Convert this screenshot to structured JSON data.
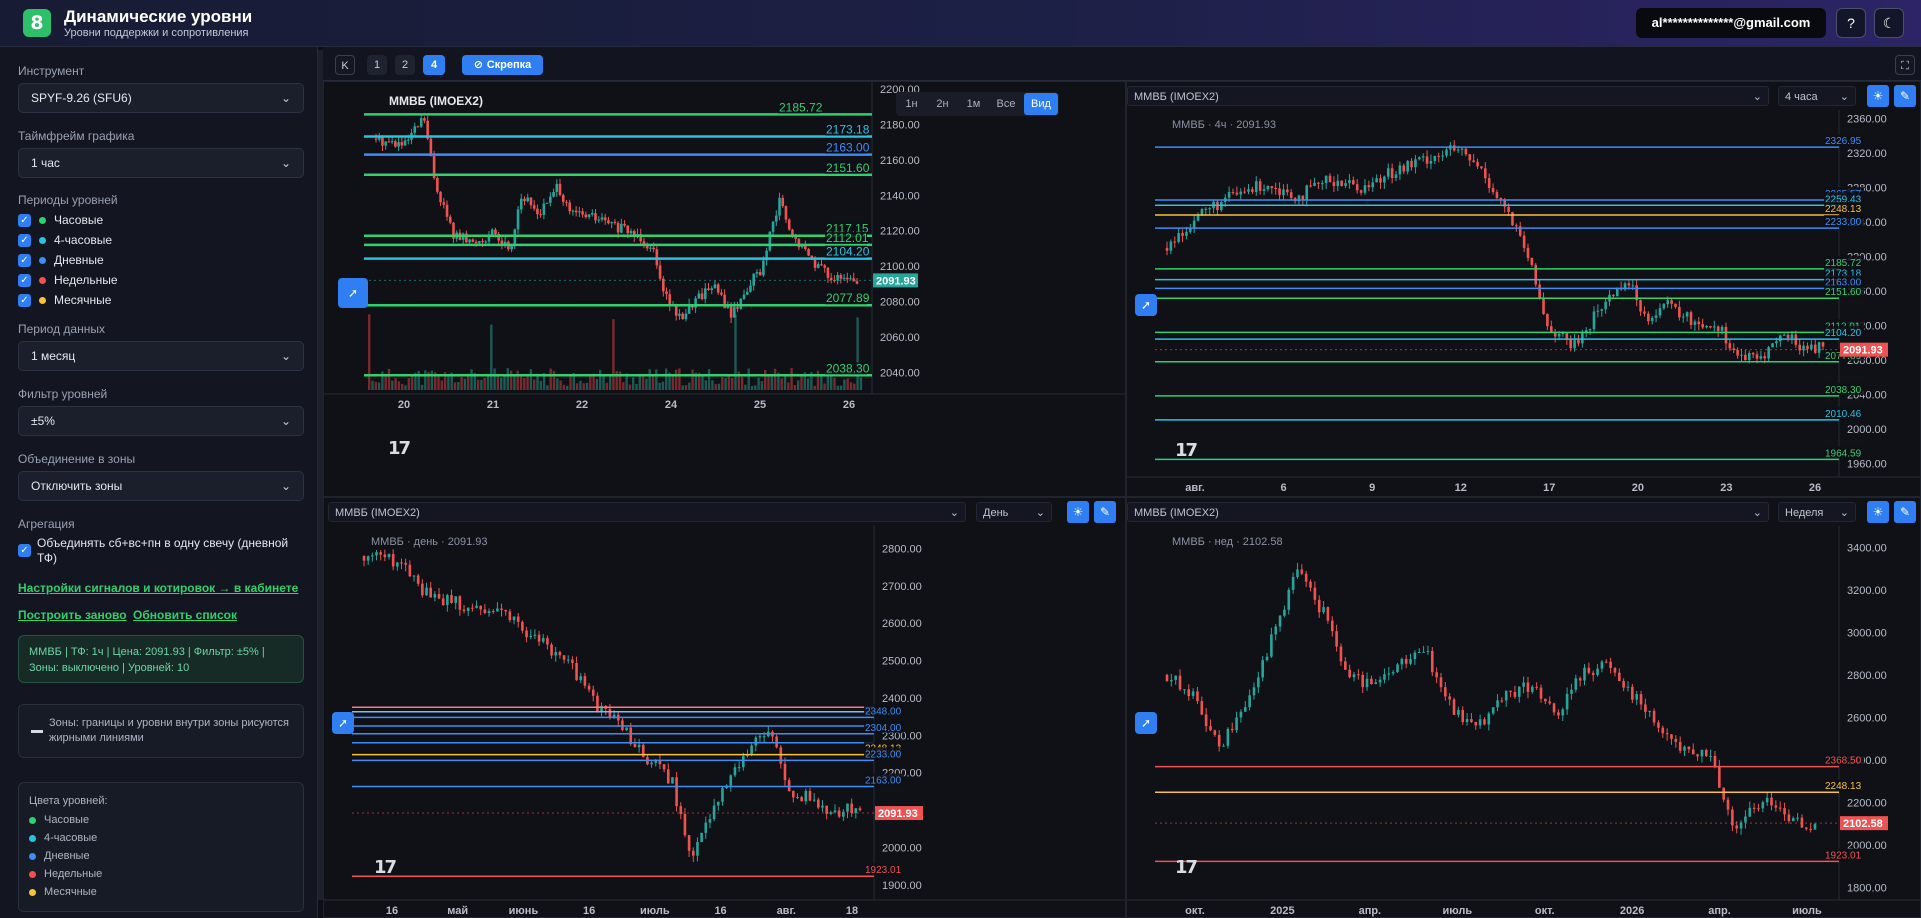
{
  "header": {
    "logo": "8",
    "title": "Динамические уровни",
    "subtitle": "Уровни поддержки и сопротивления",
    "user_email": "al**************@gmail.com",
    "help_icon": "?",
    "theme_icon": "☾"
  },
  "sidebar": {
    "instrument_label": "Инструмент",
    "instrument_value": "SPYF-9.26 (SFU6)",
    "timeframe_label": "Таймфрейм графика",
    "timeframe_value": "1 час",
    "periods_label": "Периоды уровней",
    "periods": [
      {
        "label": "Часовые",
        "color": "#2fd06e"
      },
      {
        "label": "4-часовые",
        "color": "#27c3e0"
      },
      {
        "label": "Дневные",
        "color": "#3d8df5"
      },
      {
        "label": "Недельные",
        "color": "#f05252"
      },
      {
        "label": "Месячные",
        "color": "#f7c23c"
      }
    ],
    "data_period_label": "Период данных",
    "data_period_value": "1 месяц",
    "filter_label": "Фильтр уровней",
    "filter_value": "±5%",
    "zones_label": "Объединение в зоны",
    "zones_value": "Отключить зоны",
    "aggregation_label": "Агрегация",
    "aggregation_checkbox": "Объединять сб+вс+пн в одну свечу (дневной ТФ)",
    "signals_link": "Настройки сигналов и котировок → в кабинете",
    "rebuild_link": "Построить заново",
    "refresh_link": "Обновить список",
    "info_text": "ММВБ | ТФ: 1ч | Цена: 2091.93 | Фильтр: ±5% | Зоны: выключено | Уровней: 10",
    "zones_note": "Зоны: границы и уровни внутри зоны рисуются жирными линиями",
    "legend_title": "Цвета уровней:",
    "legend": [
      {
        "label": "Часовые",
        "color": "#2fd06e"
      },
      {
        "label": "4-часовые",
        "color": "#27c3e0"
      },
      {
        "label": "Дневные",
        "color": "#3d8df5"
      },
      {
        "label": "Недельные",
        "color": "#f05252"
      },
      {
        "label": "Месячные",
        "color": "#f7c23c"
      }
    ]
  },
  "topbar": {
    "collapse": "K",
    "layouts": [
      "1",
      "2",
      "4"
    ],
    "clip_label": "Скрепка",
    "fullscreen_icon": "⛶"
  },
  "charts": [
    {
      "id": "p1",
      "header": null,
      "title": "ММВБ (IMOEX2)",
      "legend_text": "",
      "tf_buttons": [
        "1н",
        "2н",
        "1м",
        "Все",
        "Вид"
      ],
      "ymin": 2030,
      "ymax": 2204,
      "yticks": [
        2200,
        2180,
        2160,
        2140,
        2120,
        2100,
        2080,
        2060,
        2040
      ],
      "xticks": [
        "20",
        "21",
        "22",
        "24",
        "25",
        "26"
      ],
      "price": "2091.93",
      "price_color": "#26a69a",
      "levels": [
        {
          "v": 2185.72,
          "c": "#2fd06e"
        },
        {
          "v": 2173.18,
          "c": "#27c3e0"
        },
        {
          "v": 2163.0,
          "c": "#3d8df5"
        },
        {
          "v": 2151.6,
          "c": "#2fd06e"
        },
        {
          "v": 2117.15,
          "c": "#2fd06e"
        },
        {
          "v": 2112.01,
          "c": "#2fd06e"
        },
        {
          "v": 2104.2,
          "c": "#27c3e0"
        },
        {
          "v": 2077.89,
          "c": "#2fd06e"
        },
        {
          "v": 2038.3,
          "c": "#2fd06e"
        }
      ],
      "path": [
        [
          0,
          2172
        ],
        [
          0.06,
          2168
        ],
        [
          0.1,
          2184
        ],
        [
          0.12,
          2150
        ],
        [
          0.16,
          2118
        ],
        [
          0.2,
          2113
        ],
        [
          0.24,
          2118
        ],
        [
          0.28,
          2110
        ],
        [
          0.3,
          2140
        ],
        [
          0.34,
          2130
        ],
        [
          0.38,
          2145
        ],
        [
          0.4,
          2130
        ],
        [
          0.45,
          2128
        ],
        [
          0.5,
          2122
        ],
        [
          0.55,
          2117
        ],
        [
          0.58,
          2108
        ],
        [
          0.6,
          2085
        ],
        [
          0.63,
          2070
        ],
        [
          0.66,
          2080
        ],
        [
          0.7,
          2090
        ],
        [
          0.74,
          2072
        ],
        [
          0.78,
          2092
        ],
        [
          0.8,
          2097
        ],
        [
          0.84,
          2138
        ],
        [
          0.86,
          2118
        ],
        [
          0.88,
          2112
        ],
        [
          0.92,
          2100
        ],
        [
          0.96,
          2092
        ]
      ],
      "volumes": true
    },
    {
      "id": "p2",
      "header": {
        "symbol": "ММВБ (IMOEX2)",
        "tf": "4 часа"
      },
      "legend_text": "ММВБ · 4ч · 2091.93",
      "ymin": 1950,
      "ymax": 2370,
      "yticks": [
        2360,
        2320,
        2280,
        2240,
        2200,
        2160,
        2120,
        2080,
        2040,
        2000,
        1960
      ],
      "xticks": [
        "авг.",
        "6",
        "9",
        "12",
        "17",
        "20",
        "23",
        "26"
      ],
      "price": "2091.93",
      "price_color": "#f05252",
      "levels": [
        {
          "v": 2326.95,
          "c": "#3d8df5",
          "t": "2326.95"
        },
        {
          "v": 2265.57,
          "c": "#3d8df5",
          "t": "2265.57"
        },
        {
          "v": 2259.43,
          "c": "#27c3e0",
          "t": "2259.43"
        },
        {
          "v": 2248.13,
          "c": "#f7c23c",
          "t": "2248.13"
        },
        {
          "v": 2233.0,
          "c": "#3d8df5",
          "t": "2233.00"
        },
        {
          "v": 2185.72,
          "c": "#2fd06e",
          "t": "2185.72"
        },
        {
          "v": 2173.18,
          "c": "#27c3e0",
          "t": "2173.18"
        },
        {
          "v": 2163.0,
          "c": "#3d8df5",
          "t": "2163.00"
        },
        {
          "v": 2151.6,
          "c": "#2fd06e",
          "t": "2151.60"
        },
        {
          "v": 2112.01,
          "c": "#2fd06e",
          "t": "2112.01"
        },
        {
          "v": 2104.2,
          "c": "#27c3e0",
          "t": "2104.20"
        },
        {
          "v": 2077.89,
          "c": "#2fd06e",
          "t": "2077.89"
        },
        {
          "v": 2038.3,
          "c": "#2fd06e",
          "t": "2038.30"
        },
        {
          "v": 2010.46,
          "c": "#27c3e0",
          "t": "2010.46"
        },
        {
          "v": 1964.59,
          "c": "#2fd06e",
          "t": "1964.59"
        }
      ],
      "path": [
        [
          0,
          2210
        ],
        [
          0.05,
          2250
        ],
        [
          0.1,
          2270
        ],
        [
          0.15,
          2285
        ],
        [
          0.2,
          2270
        ],
        [
          0.25,
          2290
        ],
        [
          0.3,
          2280
        ],
        [
          0.35,
          2300
        ],
        [
          0.4,
          2315
        ],
        [
          0.44,
          2325
        ],
        [
          0.48,
          2300
        ],
        [
          0.52,
          2250
        ],
        [
          0.55,
          2200
        ],
        [
          0.58,
          2120
        ],
        [
          0.62,
          2095
        ],
        [
          0.66,
          2140
        ],
        [
          0.7,
          2175
        ],
        [
          0.73,
          2130
        ],
        [
          0.76,
          2145
        ],
        [
          0.8,
          2125
        ],
        [
          0.84,
          2120
        ],
        [
          0.87,
          2085
        ],
        [
          0.9,
          2080
        ],
        [
          0.94,
          2110
        ],
        [
          0.97,
          2095
        ]
      ],
      "volumes": false
    },
    {
      "id": "p3",
      "header": {
        "symbol": "ММВБ (IMOEX2)",
        "tf": "День"
      },
      "legend_text": "ММВБ · день · 2091.93",
      "ymin": 1870,
      "ymax": 2860,
      "yticks": [
        2800,
        2700,
        2600,
        2500,
        2400,
        2300,
        2200,
        2100,
        2000,
        1900
      ],
      "xticks": [
        "16",
        "май",
        "июнь",
        "16",
        "июль",
        "16",
        "авг.",
        "18"
      ],
      "price": "2091.93",
      "price_color": "#f05252",
      "levels": [
        {
          "v": 2375,
          "c": "#f08080",
          "t": ""
        },
        {
          "v": 2363,
          "c": "#7fb8ff",
          "t": ""
        },
        {
          "v": 2348.0,
          "c": "#3d8df5",
          "t": "2348.00"
        },
        {
          "v": 2325,
          "c": "#3d8df5",
          "t": ""
        },
        {
          "v": 2304.0,
          "c": "#3d8df5",
          "t": "2304.00"
        },
        {
          "v": 2280,
          "c": "#3d8df5",
          "t": ""
        },
        {
          "v": 2248.13,
          "c": "#f7c23c",
          "t": "2248.13"
        },
        {
          "v": 2233.0,
          "c": "#3d8df5",
          "t": "2233.00"
        },
        {
          "v": 2163.0,
          "c": "#3d8df5",
          "t": "2163.00"
        },
        {
          "v": 1923.01,
          "c": "#f05252",
          "t": "1923.01"
        }
      ],
      "path": [
        [
          0,
          2780
        ],
        [
          0.08,
          2760
        ],
        [
          0.12,
          2680
        ],
        [
          0.2,
          2650
        ],
        [
          0.28,
          2620
        ],
        [
          0.35,
          2560
        ],
        [
          0.42,
          2480
        ],
        [
          0.48,
          2360
        ],
        [
          0.52,
          2330
        ],
        [
          0.56,
          2250
        ],
        [
          0.62,
          2180
        ],
        [
          0.66,
          1960
        ],
        [
          0.7,
          2100
        ],
        [
          0.74,
          2200
        ],
        [
          0.78,
          2270
        ],
        [
          0.82,
          2300
        ],
        [
          0.86,
          2150
        ],
        [
          0.9,
          2130
        ],
        [
          0.93,
          2100
        ]
      ],
      "volumes": false
    },
    {
      "id": "p4",
      "header": {
        "symbol": "ММВБ (IMOEX2)",
        "tf": "Неделя"
      },
      "legend_text": "ММВБ · нед · 2102.58",
      "ymin": 1760,
      "ymax": 3500,
      "yticks": [
        3400,
        3200,
        3000,
        2800,
        2600,
        2400,
        2200,
        2000,
        1800
      ],
      "xticks": [
        "окт.",
        "2025",
        "апр.",
        "июль",
        "окт.",
        "2026",
        "апр.",
        "июль"
      ],
      "price": "2102.58",
      "price_color": "#f05252",
      "levels": [
        {
          "v": 2368.5,
          "c": "#f05252",
          "t": "2368.50"
        },
        {
          "v": 2248.13,
          "c": "#f7c23c",
          "t": "2248.13"
        },
        {
          "v": 1923.01,
          "c": "#f05252",
          "t": "1923.01"
        }
      ],
      "path": [
        [
          0,
          2800
        ],
        [
          0.04,
          2700
        ],
        [
          0.08,
          2450
        ],
        [
          0.12,
          2650
        ],
        [
          0.16,
          2950
        ],
        [
          0.2,
          3300
        ],
        [
          0.24,
          3100
        ],
        [
          0.28,
          2800
        ],
        [
          0.32,
          2750
        ],
        [
          0.36,
          2850
        ],
        [
          0.4,
          2900
        ],
        [
          0.44,
          2650
        ],
        [
          0.48,
          2550
        ],
        [
          0.52,
          2700
        ],
        [
          0.56,
          2750
        ],
        [
          0.6,
          2600
        ],
        [
          0.64,
          2800
        ],
        [
          0.68,
          2850
        ],
        [
          0.72,
          2700
        ],
        [
          0.76,
          2550
        ],
        [
          0.8,
          2450
        ],
        [
          0.84,
          2400
        ],
        [
          0.88,
          2050
        ],
        [
          0.9,
          2150
        ],
        [
          0.93,
          2200
        ],
        [
          0.96,
          2100
        ]
      ],
      "volumes": false
    }
  ]
}
